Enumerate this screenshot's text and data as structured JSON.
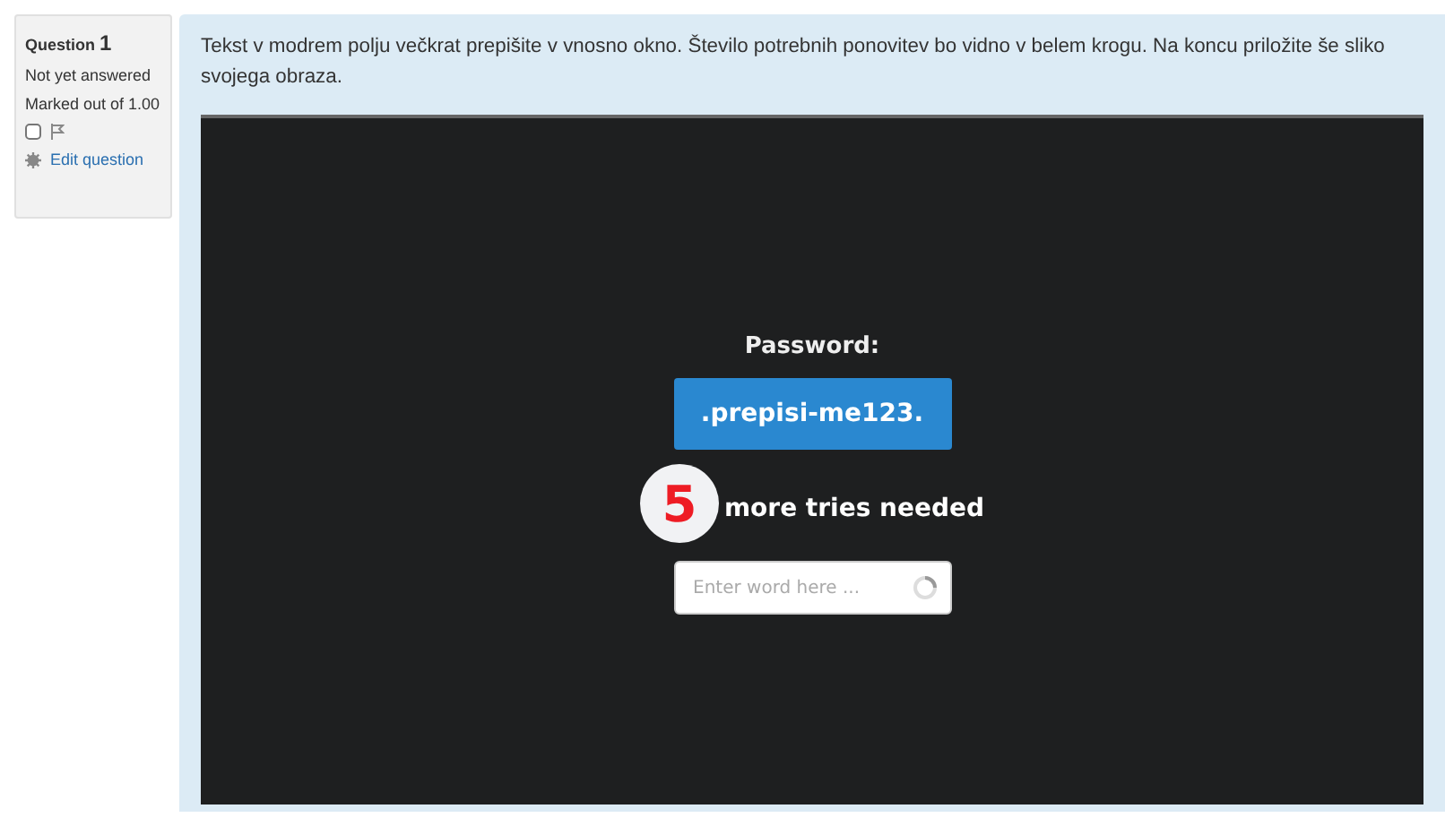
{
  "question_info": {
    "label": "Question",
    "number": "1",
    "status": "Not yet answered",
    "marks": "Marked out of 1.00",
    "flagged": false,
    "edit_link": "Edit question"
  },
  "question_text": "Tekst v modrem polju večkrat prepišite v vnosno okno. Število potrebnih ponovitev bo vidno v belem krogu. Na koncu priložite še sliko svojega obraza.",
  "widget": {
    "password_label": "Password:",
    "password": ".prepisi-me123.",
    "tries_count": "5",
    "tries_label": "more tries needed",
    "input": {
      "placeholder": "Enter word here ..."
    }
  }
}
